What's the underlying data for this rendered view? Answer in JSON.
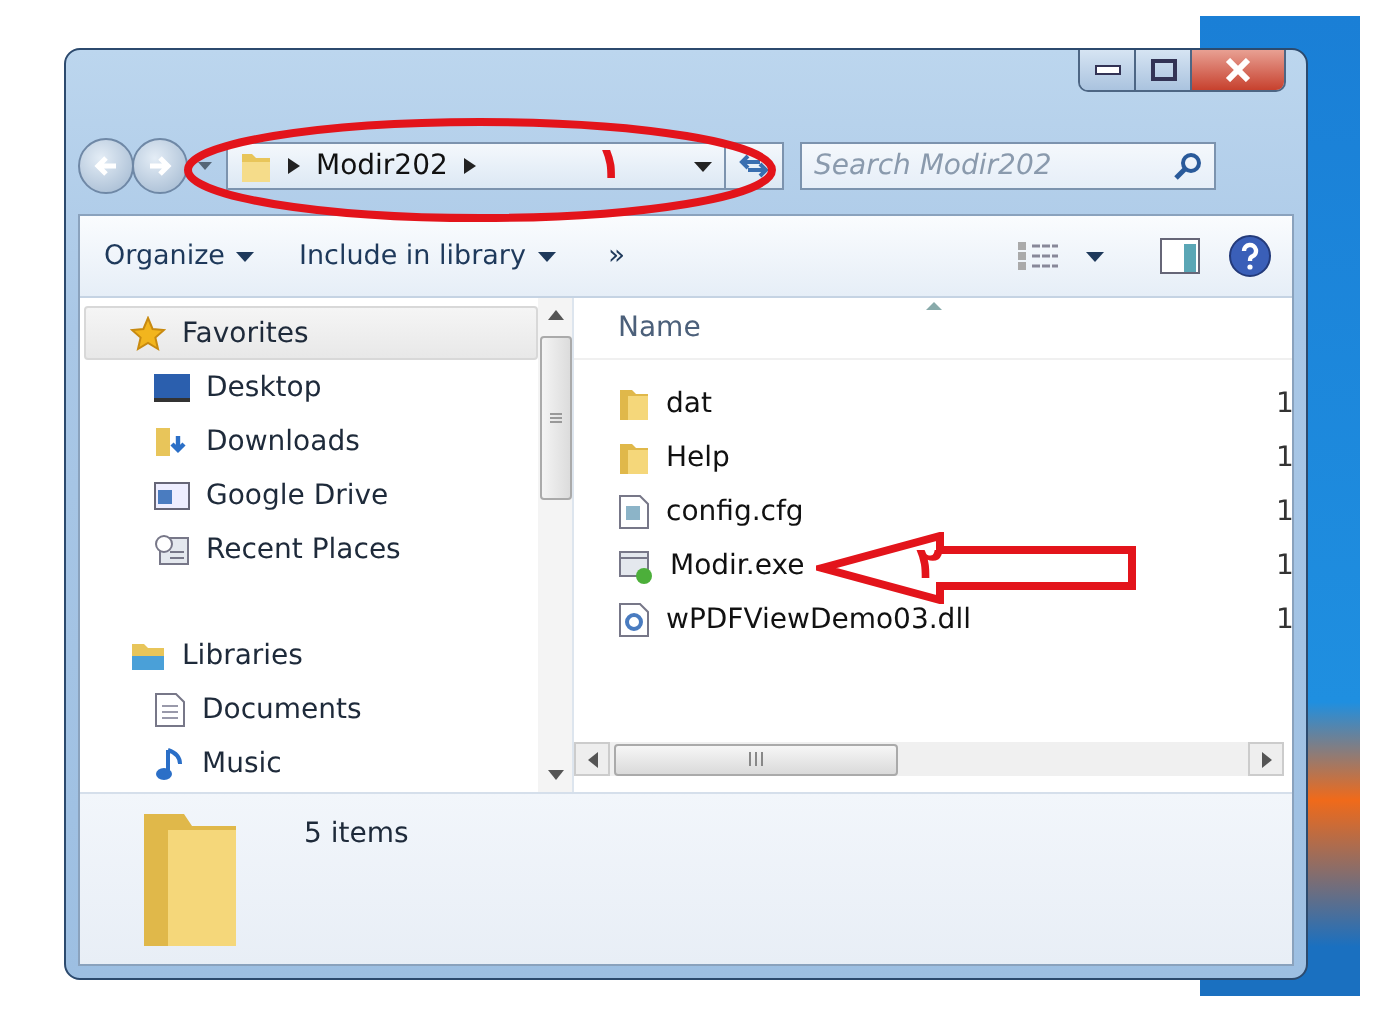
{
  "address_bar": {
    "path": [
      "Modir202"
    ]
  },
  "search": {
    "placeholder": "Search Modir202"
  },
  "toolbar": {
    "items": [
      {
        "kind": "menu",
        "label": "Organize"
      },
      {
        "kind": "menu",
        "label": "Include in library"
      },
      {
        "kind": "overflow",
        "label": "»"
      }
    ]
  },
  "navigation_pane": {
    "groups": [
      {
        "label": "Favorites",
        "kind": "favorites",
        "selected": true,
        "children": [
          {
            "label": "Desktop",
            "kind": "desktop",
            "selected": false
          },
          {
            "label": "Downloads",
            "kind": "downloads",
            "selected": false
          },
          {
            "label": "Google Drive",
            "kind": "drive",
            "selected": false
          },
          {
            "label": "Recent Places",
            "kind": "recent",
            "selected": false
          }
        ]
      },
      {
        "label": "Libraries",
        "kind": "libraries",
        "selected": false,
        "children": [
          {
            "label": "Documents",
            "kind": "documents",
            "selected": false
          },
          {
            "label": "Music",
            "kind": "music",
            "selected": false
          }
        ]
      }
    ]
  },
  "file_list": {
    "columns": [
      "Name"
    ],
    "rows": [
      {
        "name": "dat",
        "kind": "folder",
        "column_2": "1"
      },
      {
        "name": "Help",
        "kind": "folder",
        "column_2": "1"
      },
      {
        "name": "config.cfg",
        "kind": "config",
        "column_2": "1"
      },
      {
        "name": "Modir.exe",
        "kind": "exe",
        "column_2": "1"
      },
      {
        "name": "wPDFViewDemo03.dll",
        "kind": "dll",
        "column_2": "1"
      }
    ]
  },
  "details_pane": {
    "text": "5 items"
  },
  "annotations": [
    {
      "kind": "ellipse",
      "label": "۱"
    },
    {
      "kind": "arrow",
      "label": "۲"
    }
  ]
}
